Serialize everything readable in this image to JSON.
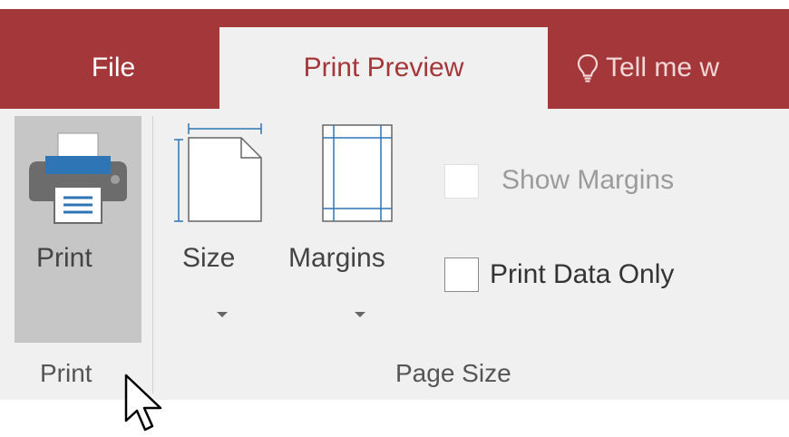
{
  "tabs": {
    "file": "File",
    "print_preview": "Print Preview",
    "tell_me": "Tell me w"
  },
  "ribbon": {
    "print_button": {
      "label": "Print",
      "icon": "printer-icon"
    },
    "size_button": {
      "label": "Size",
      "icon": "page-size-icon"
    },
    "margins_button": {
      "label": "Margins",
      "icon": "margins-icon"
    },
    "show_margins": {
      "label": "Show Margins",
      "checked": false,
      "enabled": false
    },
    "print_data_only": {
      "label": "Print Data Only",
      "checked": false,
      "enabled": true
    },
    "groups": {
      "print": "Print",
      "page_size": "Page Size"
    }
  },
  "colors": {
    "accent": "#a4373a",
    "ribbon_bg": "#f0f0f0",
    "selected_button_bg": "#c6c6c6"
  }
}
